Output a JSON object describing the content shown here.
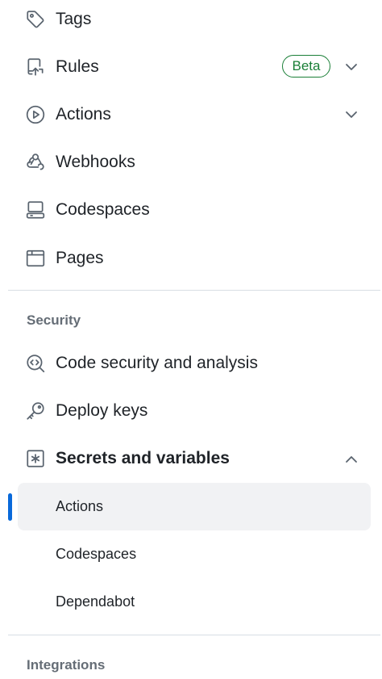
{
  "nav_items": [
    {
      "label": "Tags"
    },
    {
      "label": "Rules",
      "badge": "Beta"
    },
    {
      "label": "Actions"
    },
    {
      "label": "Webhooks"
    },
    {
      "label": "Codespaces"
    },
    {
      "label": "Pages"
    }
  ],
  "security": {
    "heading": "Security",
    "items": [
      {
        "label": "Code security and analysis"
      },
      {
        "label": "Deploy keys"
      },
      {
        "label": "Secrets and variables"
      }
    ],
    "secrets_subitems": [
      {
        "label": "Actions",
        "selected": true
      },
      {
        "label": "Codespaces",
        "selected": false
      },
      {
        "label": "Dependabot",
        "selected": false
      }
    ]
  },
  "integrations": {
    "heading": "Integrations"
  },
  "colors": {
    "accent": "#0969da",
    "badge_green": "#1a7f37",
    "muted_text": "#656d76",
    "selected_bg": "#f1f2f4",
    "divider": "#d8dee4"
  },
  "icons": {
    "tags": "tag-icon",
    "rules": "repo-push-icon",
    "actions": "play-icon",
    "webhooks": "webhook-icon",
    "codespaces": "codespaces-icon",
    "pages": "browser-icon",
    "code_security": "codescan-icon",
    "deploy_keys": "key-icon",
    "secrets": "asterisk-icon"
  }
}
